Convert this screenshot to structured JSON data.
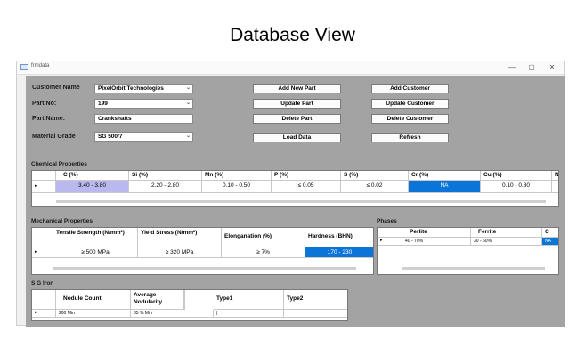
{
  "page_title": "Database View",
  "window": {
    "title": "frmdata",
    "minimize_glyph": "—",
    "maximize_glyph": "▢",
    "close_glyph": "✕",
    "app_icon": "app-window-icon"
  },
  "form": {
    "customer_name_label": "Customer Name",
    "customer_name_value": "PixelOrbit Technologies",
    "part_no_label": "Part No:",
    "part_no_value": "199",
    "part_name_label": "Part Name:",
    "part_name_value": "Crankshafts",
    "material_grade_label": "Material Grade",
    "material_grade_value": "SG 500/7",
    "combo_arrow": "⌄"
  },
  "buttons": {
    "add_new_part": "Add New Part",
    "update_part": "Update Part",
    "delete_part": "Delete Part",
    "load_data": "Load Data",
    "add_customer": "Add Customer",
    "update_customer": "Update Customer",
    "delete_customer": "Delete Customer",
    "refresh": "Refresh"
  },
  "chemical": {
    "title": "Chemical Properties",
    "row_marker": "▸",
    "headers": [
      "C (%)",
      "Si (%)",
      "Mn (%)",
      "P (%)",
      "S (%)",
      "Cr (%)",
      "Cu (%)",
      "N"
    ],
    "row": [
      "3.40 - 3.80",
      "2.20 - 2.80",
      "0.10 - 0.50",
      "≤ 0.05",
      "≤ 0.02",
      "NA",
      "0.10 - 0.80",
      ""
    ],
    "highlight_color": "#b9b9f0",
    "selected_color": "#0a74d8"
  },
  "mechanical": {
    "title": "Mechanical Properties",
    "row_marker": "▸",
    "headers": [
      "Tensile Strength (N/mm²)",
      "Yield Stress (N/mm²)",
      "Elonganation (%)",
      "Hardness (BHN)"
    ],
    "row": [
      "≥ 500 MPa",
      "≥ 320 MPa",
      "≥ 7%",
      "170 - 230"
    ]
  },
  "phases": {
    "title": "Phases",
    "row_marker": "▸",
    "headers": [
      "Perlite",
      "Ferrite",
      "C"
    ],
    "row": [
      "40 - 70%",
      "30 - 60%",
      "NA"
    ]
  },
  "sg_iron": {
    "title": "S G Iron",
    "row_marker": "▸",
    "headers": [
      "Nodule Count",
      "Average Nodularity",
      "Type1",
      "Type2"
    ],
    "row": [
      "200 Min",
      "85 % Min",
      "|",
      ""
    ]
  }
}
